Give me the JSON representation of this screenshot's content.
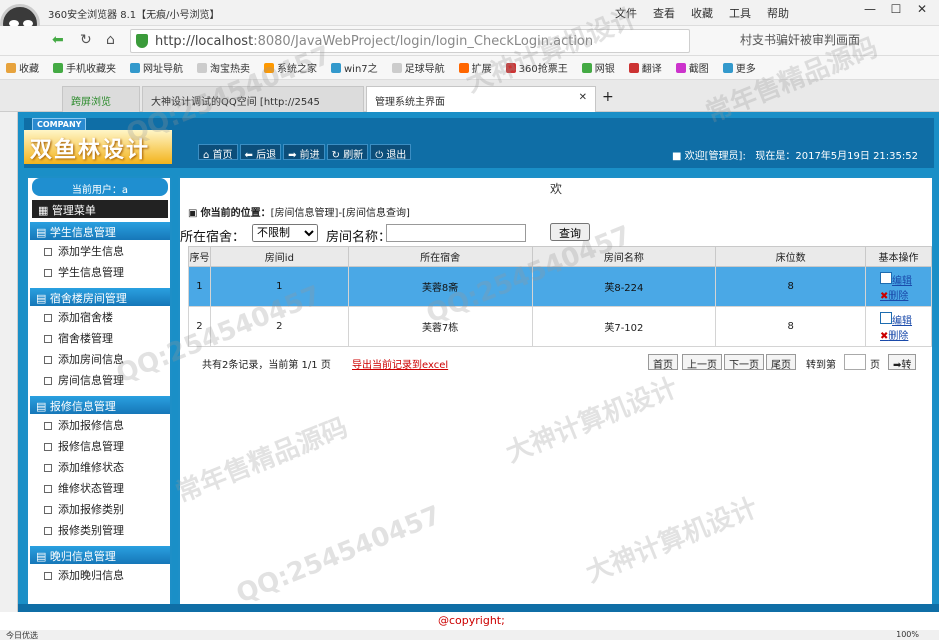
{
  "browser": {
    "title": "360安全浏览器 8.1【无痕/小号浏览】",
    "menus": [
      "文件",
      "查看",
      "收藏",
      "工具",
      "帮助"
    ],
    "url_host": "http://localhost",
    "url_path": ":8080/JavaWebProject/login/login_CheckLogin.action",
    "search_text": "村支书骗奸被审判画面",
    "bookmarks": [
      "收藏",
      "手机收藏夹",
      "网址导航",
      "淘宝热卖",
      "系统之家",
      "win7之",
      "足球导航",
      "扩展",
      "360抢票王",
      "网银",
      "翻译",
      "截图",
      "更多"
    ],
    "tabs": [
      "跨屏浏览",
      "大神设计调试的QQ空间 [http://2545",
      "管理系统主界面"
    ],
    "status_left": "今日优选",
    "status_right": "100%"
  },
  "app": {
    "company": "COMPANY",
    "name": "双鱼林设计",
    "nav": [
      "首页",
      "后退",
      "前进",
      "刷新",
      "退出"
    ],
    "welcome": "欢迎[管理员]:",
    "now_label": "现在是：2017年5月19日 21:35:52",
    "current_user_label": "当前用户：a",
    "menu_title": "管理菜单",
    "welcome_strip": "欢",
    "copyright": "@copyright;"
  },
  "menu": [
    {
      "title": "学生信息管理",
      "items": [
        "添加学生信息",
        "学生信息管理"
      ]
    },
    {
      "title": "宿舍楼房间管理",
      "items": [
        "添加宿舍楼",
        "宿舍楼管理",
        "添加房间信息",
        "房间信息管理"
      ]
    },
    {
      "title": "报修信息管理",
      "items": [
        "添加报修信息",
        "报修信息管理",
        "添加维修状态",
        "维修状态管理",
        "添加报修类别",
        "报修类别管理"
      ]
    },
    {
      "title": "晚归信息管理",
      "items": [
        "添加晚归信息"
      ]
    }
  ],
  "main": {
    "location_prefix": "你当前的位置：",
    "location_path": "[房间信息管理]-[房间信息查询]",
    "filter_building_label": "所在宿舍：",
    "filter_building_value": "不限制",
    "filter_room_label": "房间名称：",
    "query_button": "查询",
    "columns": [
      "序号",
      "房间id",
      "所在宿舍",
      "房间名称",
      "床位数",
      "基本操作"
    ],
    "rows": [
      {
        "no": "1",
        "id": "1",
        "building": "芙蓉8斋",
        "name": "芙8-224",
        "beds": "8"
      },
      {
        "no": "2",
        "id": "2",
        "building": "芙蓉7栋",
        "name": "芙7-102",
        "beds": "8"
      }
    ],
    "op_edit": "编辑",
    "op_delete": "删除",
    "pager_info": "共有2条记录，当前第 1/1 页",
    "export": "导出当前记录到excel",
    "first": "首页",
    "prev": "上一页",
    "next": "下一页",
    "last": "尾页",
    "goto_label": "转到第",
    "page_unit": "页",
    "go": "➡转"
  },
  "watermarks": [
    "QQ:254540457",
    "大神计算机设计",
    "常年售精品源码",
    "QQ:254540457",
    "大神计算机设计",
    "常年售精品源码",
    "QQ:254540457",
    "大神计算机设计",
    "QQ:254540457"
  ]
}
